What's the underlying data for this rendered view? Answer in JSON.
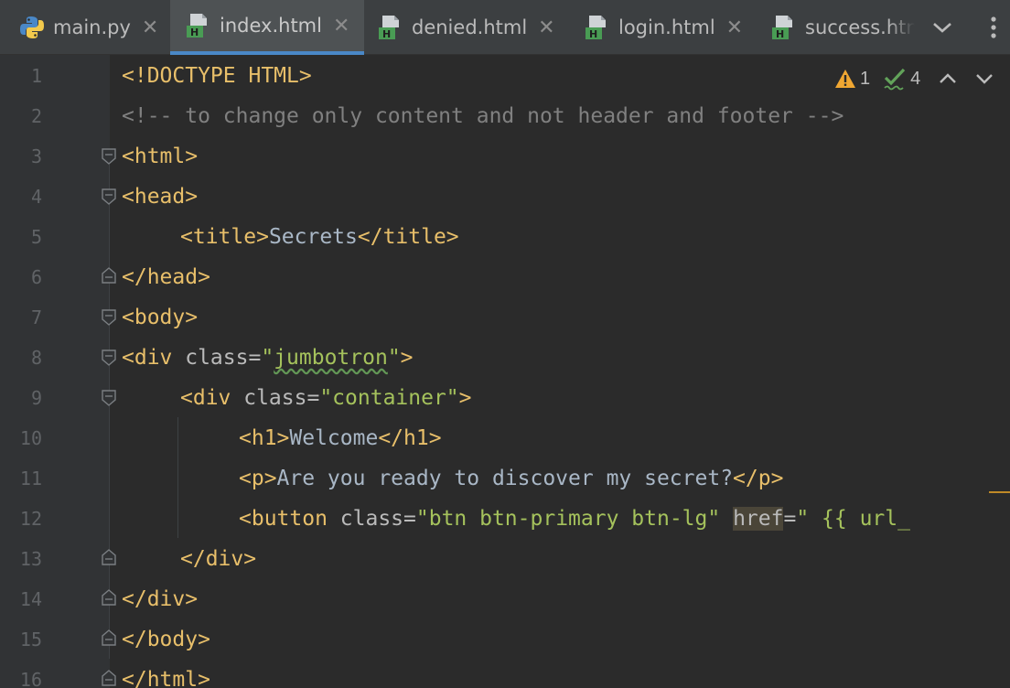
{
  "tabs": [
    {
      "label": "main.py",
      "icon": "python-file-icon",
      "active": false
    },
    {
      "label": "index.html",
      "icon": "html-file-icon",
      "active": true
    },
    {
      "label": "denied.html",
      "icon": "html-file-icon",
      "active": false
    },
    {
      "label": "login.html",
      "icon": "html-file-icon",
      "active": false
    },
    {
      "label": "success.html",
      "icon": "html-file-icon",
      "active": false
    }
  ],
  "inspections": {
    "warnings": "1",
    "weak_warnings": "4"
  },
  "lines": [
    "1",
    "2",
    "3",
    "4",
    "5",
    "6",
    "7",
    "8",
    "9",
    "10",
    "11",
    "12",
    "13",
    "14",
    "15",
    "16"
  ],
  "code": {
    "l1": "<!DOCTYPE HTML>",
    "l2": "<!-- to change only content and not header and footer -->",
    "l3": "<html>",
    "l4": "<head>",
    "l5_open": "<title>",
    "l5_text": "Secrets",
    "l5_close": "</title>",
    "l6": "</head>",
    "l7": "<body>",
    "l8_open": "<div",
    "l8_attr": " class=",
    "l8_q1": "\"",
    "l8_val": "jumbotron",
    "l8_q2": "\"",
    "l8_close": ">",
    "l9_open": "<div",
    "l9_attr": " class=",
    "l9_val": "\"container\"",
    "l9_close": ">",
    "l10_open": "<h1>",
    "l10_text": "Welcome",
    "l10_close": "</h1>",
    "l11_open": "<p>",
    "l11_text": "Are you ready to discover my secret?",
    "l11_close": "</p>",
    "l12_open": "<button",
    "l12_attr": " class=",
    "l12_val": "\"btn btn-primary btn-lg\"",
    "l12_sp": " ",
    "l12_href": "href",
    "l12_eq": "=",
    "l12_val2": "\" {{ url_",
    "l13": "</div>",
    "l14": "</div>",
    "l15": "</body>",
    "l16": "</html>"
  },
  "colors": {
    "tag": "#e8bf6a",
    "attribute": "#bababa",
    "value": "#a5c25c",
    "comment": "#808080",
    "text": "#a9b7c6",
    "active_tab_underline": "#4a88c7"
  }
}
